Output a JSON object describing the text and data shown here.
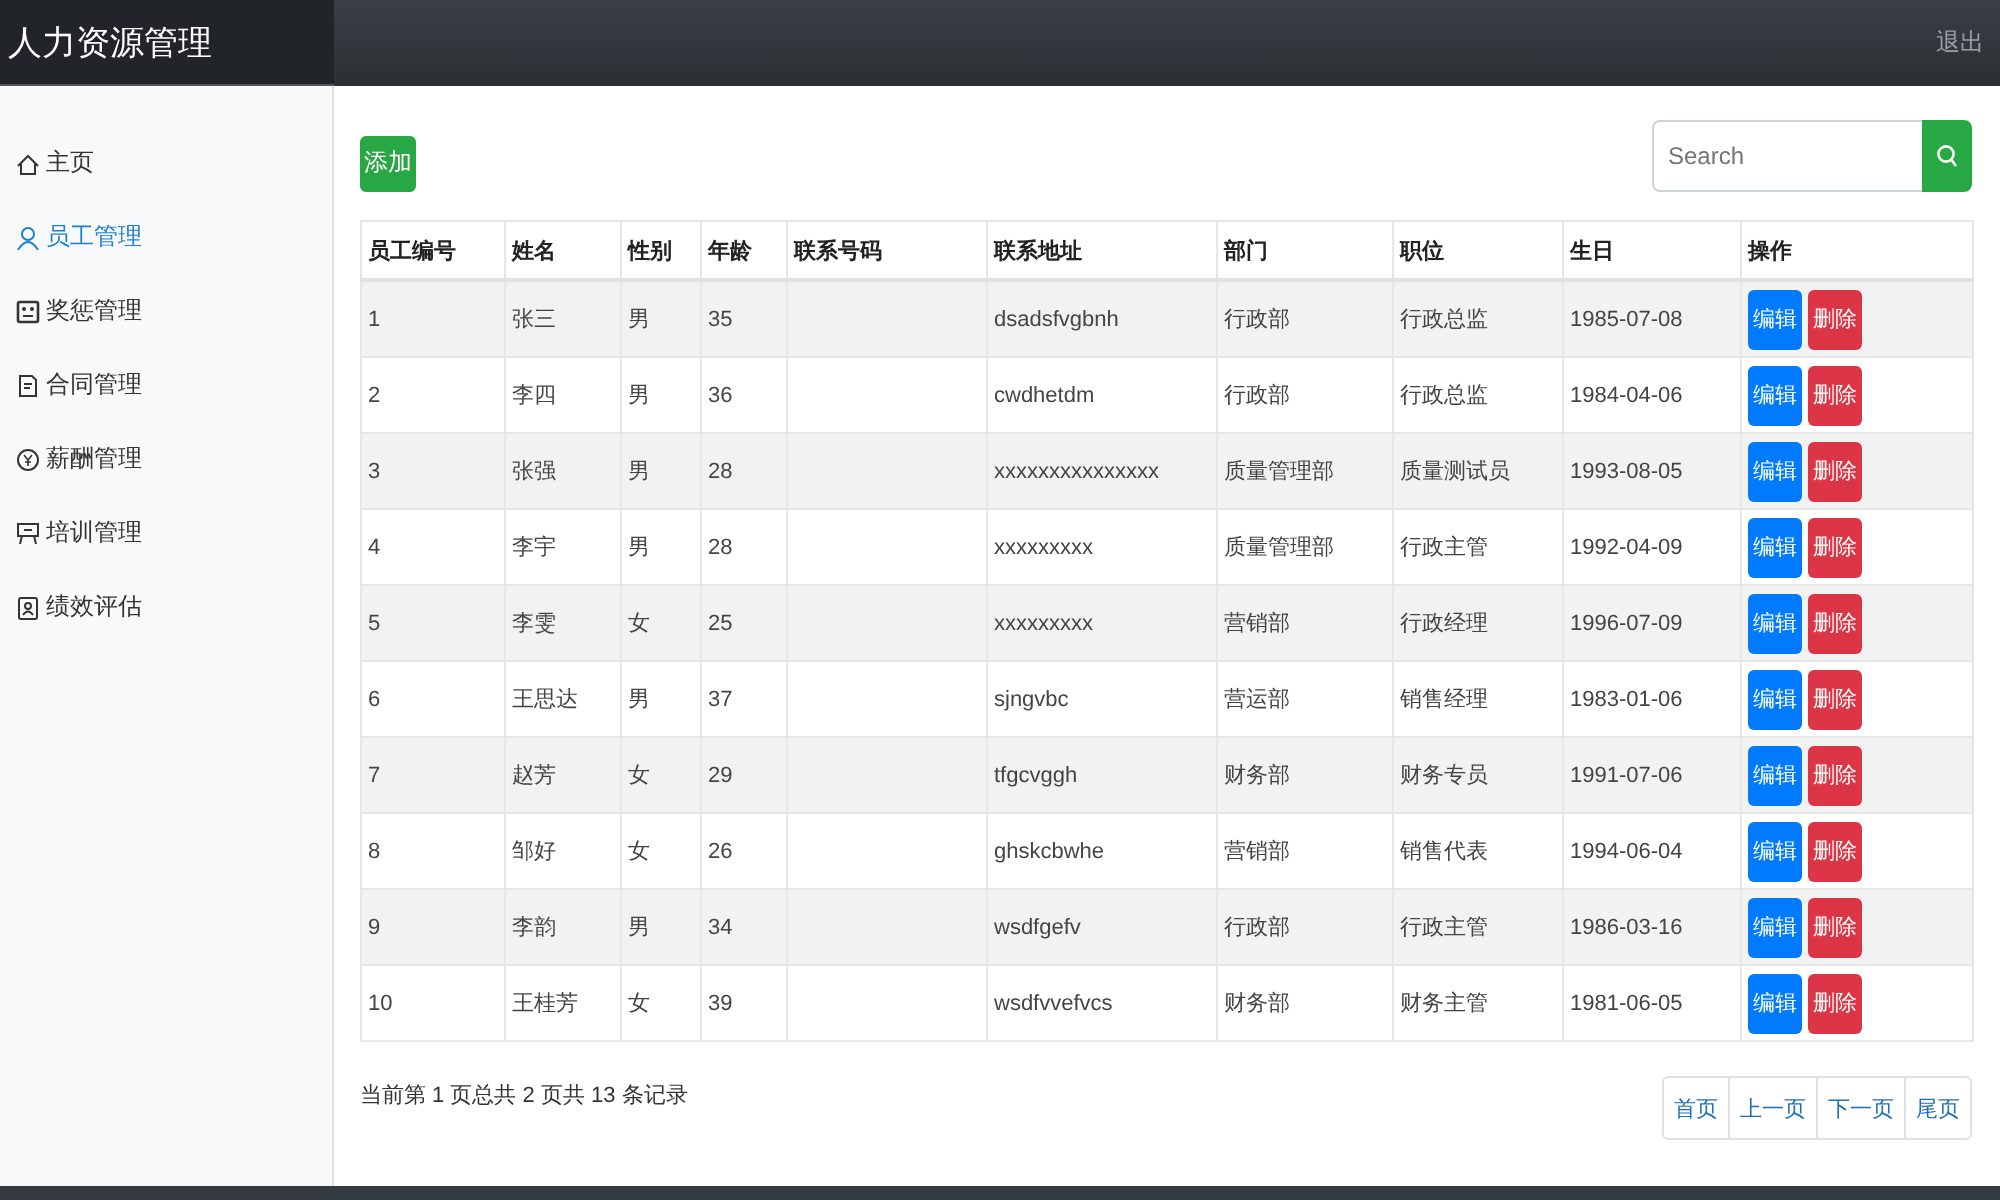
{
  "header": {
    "title": "人力资源管理",
    "logout": "退出"
  },
  "sidebar": {
    "items": [
      {
        "label": "主页",
        "selected": false
      },
      {
        "label": "员工管理",
        "selected": true
      },
      {
        "label": "奖惩管理",
        "selected": false
      },
      {
        "label": "合同管理",
        "selected": false
      },
      {
        "label": "薪酬管理",
        "selected": false
      },
      {
        "label": "培训管理",
        "selected": false
      },
      {
        "label": "绩效评估",
        "selected": false
      }
    ]
  },
  "toolbar": {
    "add_button": "添加",
    "search": {
      "placeholder": "Search"
    }
  },
  "table": {
    "columns": [
      "员工编号",
      "姓名",
      "性别",
      "年龄",
      "联系号码",
      "联系地址",
      "部门",
      "职位",
      "生日",
      "操作"
    ],
    "rows": [
      {
        "cells": [
          "1",
          "张三",
          "男",
          "35",
          "",
          "dsadsfvgbnh",
          "行政部",
          "行政总监",
          "1985-07-08"
        ],
        "actions": [
          "编辑",
          "删除"
        ]
      },
      {
        "cells": [
          "2",
          "李四",
          "男",
          "36",
          "",
          "cwdhetdm",
          "行政部",
          "行政总监",
          "1984-04-06"
        ],
        "actions": [
          "编辑",
          "删除"
        ]
      },
      {
        "cells": [
          "3",
          "张强",
          "男",
          "28",
          "",
          "xxxxxxxxxxxxxxx",
          "质量管理部",
          "质量测试员",
          "1993-08-05"
        ],
        "actions": [
          "编辑",
          "删除"
        ]
      },
      {
        "cells": [
          "4",
          "李宇",
          "男",
          "28",
          "",
          "xxxxxxxxx",
          "质量管理部",
          "行政主管",
          "1992-04-09"
        ],
        "actions": [
          "编辑",
          "删除"
        ]
      },
      {
        "cells": [
          "5",
          "李雯",
          "女",
          "25",
          "",
          "xxxxxxxxx",
          "营销部",
          "行政经理",
          "1996-07-09"
        ],
        "actions": [
          "编辑",
          "删除"
        ]
      },
      {
        "cells": [
          "6",
          "王思达",
          "男",
          "37",
          "",
          "sjngvbc",
          "营运部",
          "销售经理",
          "1983-01-06"
        ],
        "actions": [
          "编辑",
          "删除"
        ]
      },
      {
        "cells": [
          "7",
          "赵芳",
          "女",
          "29",
          "",
          "tfgcvggh",
          "财务部",
          "财务专员",
          "1991-07-06"
        ],
        "actions": [
          "编辑",
          "删除"
        ]
      },
      {
        "cells": [
          "8",
          "邹好",
          "女",
          "26",
          "",
          "ghskcbwhe",
          "营销部",
          "销售代表",
          "1994-06-04"
        ],
        "actions": [
          "编辑",
          "删除"
        ]
      },
      {
        "cells": [
          "9",
          "李韵",
          "男",
          "34",
          "",
          "wsdfgefv",
          "行政部",
          "行政主管",
          "1986-03-16"
        ],
        "actions": [
          "编辑",
          "删除"
        ]
      },
      {
        "cells": [
          "10",
          "王桂芳",
          "女",
          "39",
          "",
          "wsdfvvefvcs",
          "财务部",
          "财务主管",
          "1981-06-05"
        ],
        "actions": [
          "编辑",
          "删除"
        ]
      }
    ]
  },
  "pagination": {
    "summary": "当前第 1 页总共 2 页共 13 条记录",
    "buttons": [
      "首页",
      "上一页",
      "下一页",
      "尾页"
    ]
  }
}
